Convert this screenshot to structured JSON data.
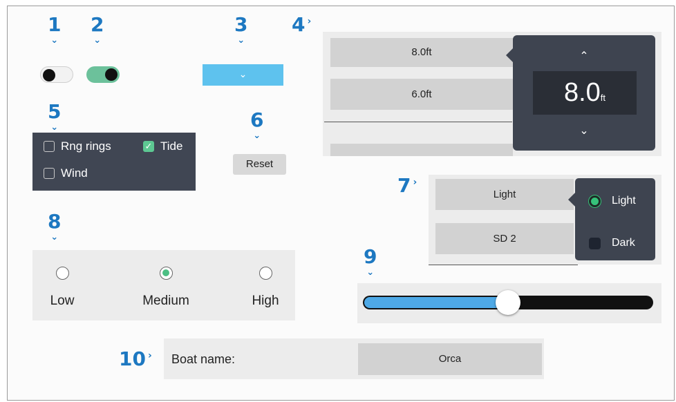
{
  "callouts": [
    "1",
    "2",
    "3",
    "4",
    "5",
    "6",
    "7",
    "8",
    "9",
    "10"
  ],
  "toggles": [
    {
      "state": "off"
    },
    {
      "state": "on"
    }
  ],
  "checkboxes": [
    {
      "label": "Rng rings",
      "checked": false
    },
    {
      "label": "Tide",
      "checked": true
    },
    {
      "label": "Wind",
      "checked": false
    }
  ],
  "reset_label": "Reset",
  "depth": {
    "fields": [
      "8.0ft",
      "6.0ft"
    ],
    "spinner_value": "8.0",
    "spinner_unit": "ft"
  },
  "theme": {
    "fields": [
      "Light",
      "SD 2"
    ],
    "options": [
      {
        "label": "Light",
        "selected": true
      },
      {
        "label": "Dark",
        "selected": false
      }
    ]
  },
  "radio": {
    "options": [
      {
        "label": "Low",
        "selected": false
      },
      {
        "label": "Medium",
        "selected": true
      },
      {
        "label": "High",
        "selected": false
      }
    ]
  },
  "slider": {
    "fraction": 0.5
  },
  "boat": {
    "label": "Boat name:",
    "value": "Orca"
  },
  "colors": {
    "accent_blue": "#1d78c1",
    "toggle_on": "#6cc19b",
    "dropdown": "#5ec2ee",
    "selected_green": "#4cbf84",
    "slider_fill": "#4ea9e6"
  }
}
